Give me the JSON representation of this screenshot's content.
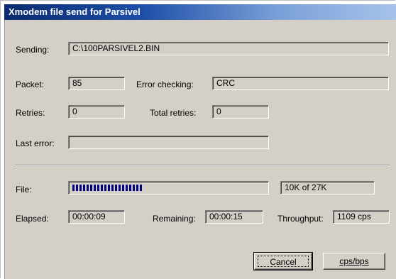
{
  "window": {
    "title": "Xmodem file send for Parsivel"
  },
  "sending": {
    "label": "Sending:",
    "value": "C:\\100PARSIVEL2.BIN"
  },
  "packet": {
    "label": "Packet:",
    "value": "85"
  },
  "error_checking": {
    "label": "Error checking:",
    "value": "CRC"
  },
  "retries": {
    "label": "Retries:",
    "value": "0"
  },
  "total_retries": {
    "label": "Total retries:",
    "value": "0"
  },
  "last_error": {
    "label": "Last error:",
    "value": ""
  },
  "file": {
    "label": "File:",
    "progress_fraction": 0.37,
    "progress_text": "10K of 27K"
  },
  "elapsed": {
    "label": "Elapsed:",
    "value": "00:00:09"
  },
  "remaining": {
    "label": "Remaining:",
    "value": "00:00:15"
  },
  "throughput": {
    "label": "Throughput:",
    "value": "1109 cps"
  },
  "buttons": {
    "cancel": "Cancel",
    "cps_bps": "cps/bps"
  }
}
